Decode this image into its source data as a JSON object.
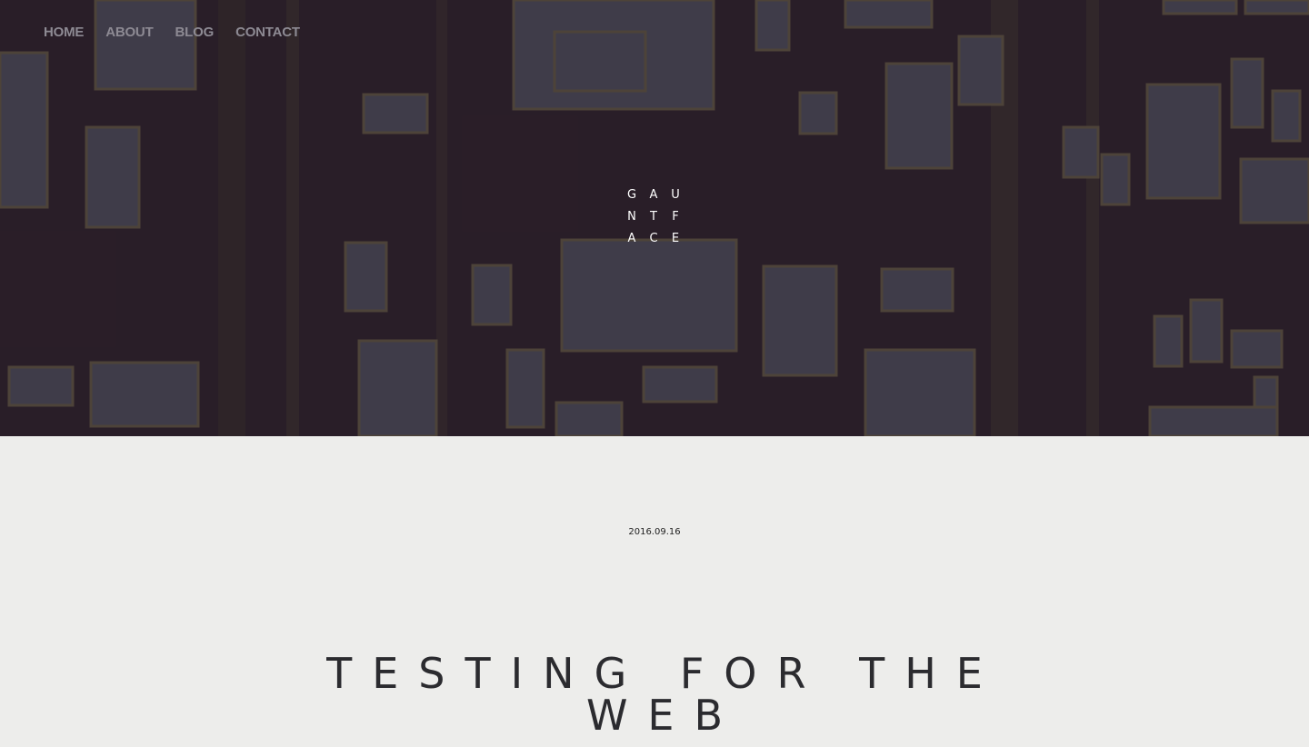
{
  "nav": {
    "items": [
      {
        "label": "HOME"
      },
      {
        "label": "ABOUT"
      },
      {
        "label": "BLOG"
      },
      {
        "label": "CONTACT"
      }
    ]
  },
  "logo": {
    "letters": [
      "G",
      "A",
      "U",
      "N",
      "T",
      "F",
      "A",
      "C",
      "E"
    ]
  },
  "post": {
    "date": "2016.09.16",
    "title": "TESTING FOR THE WEB"
  },
  "colors": {
    "hero_overlay": "#1c1622",
    "nav_text": "#8d8a93",
    "page_background": "#ededeb",
    "title_text": "#2b2b2f"
  }
}
